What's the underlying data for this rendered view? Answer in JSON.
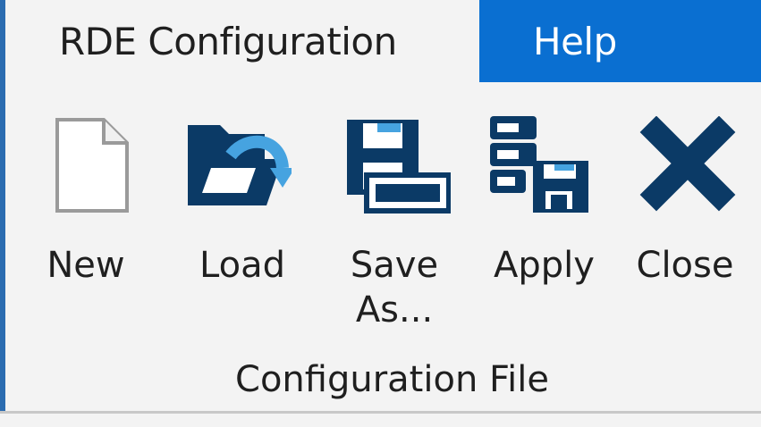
{
  "tabs": {
    "rde_configuration": "RDE Configuration",
    "help": "Help"
  },
  "commands": {
    "new": "New",
    "load": "Load",
    "save_as_line1": "Save",
    "save_as_line2": "As...",
    "apply": "Apply",
    "close": "Close"
  },
  "group": {
    "label": "Configuration File"
  },
  "colors": {
    "accent": "#0a6fd1",
    "icon_navy": "#0b3a66",
    "icon_light_blue": "#46a3e0"
  },
  "icons": {
    "new": "new-document-icon",
    "load": "open-folder-icon",
    "save_as": "save-as-icon",
    "apply": "apply-config-icon",
    "close": "close-x-icon"
  }
}
